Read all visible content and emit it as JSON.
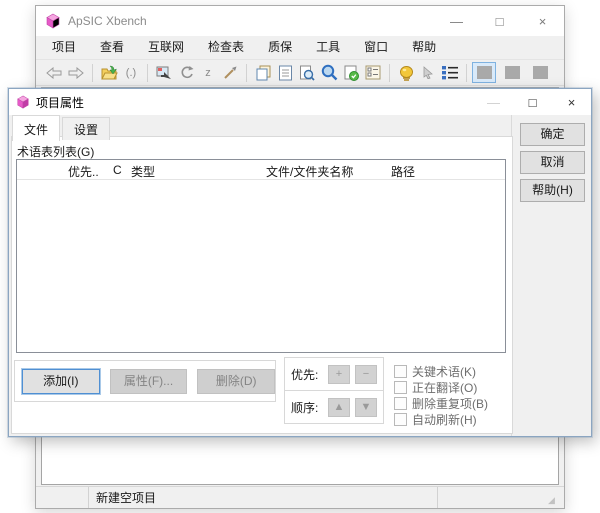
{
  "main_window": {
    "title": "ApSIC Xbench",
    "window_controls": {
      "minimize": "—",
      "maximize": "□",
      "close": "×"
    },
    "menu": [
      "项目",
      "查看",
      "互联网",
      "检查表",
      "质保",
      "工具",
      "窗口",
      "帮助"
    ],
    "toolbar_icons": [
      "back",
      "forward",
      "open-folder",
      "brackets",
      "image-edit",
      "rotate",
      "z",
      "wand",
      "copy",
      "document",
      "search-document",
      "search",
      "checked-document",
      "checklist",
      "lamp",
      "pointer",
      "list-view",
      "layout-pane-1",
      "layout-pane-2",
      "layout-pane-3"
    ],
    "status_bar": {
      "message": "新建空项目"
    }
  },
  "dialog": {
    "title": "项目属性",
    "window_controls": {
      "minimize": "—",
      "maximize": "□",
      "close": "×"
    },
    "tabs": [
      "文件",
      "设置"
    ],
    "active_tab": "文件",
    "glossary_list_label": "术语表列表(G)",
    "table": {
      "columns": [
        "",
        "优先..",
        "C",
        "类型",
        "文件/文件夹名称",
        "路径"
      ],
      "rows": []
    },
    "buttons": {
      "add": "添加(I)",
      "properties": "属性(F)...",
      "delete": "删除(D)"
    },
    "priority": {
      "label": "优先:",
      "increase": "+",
      "decrease": "−"
    },
    "order": {
      "label": "顺序:",
      "up": "▲",
      "down": "▼"
    },
    "checkboxes": [
      {
        "label": "关键术语(K)",
        "checked": false
      },
      {
        "label": "正在翻译(O)",
        "checked": false
      },
      {
        "label": "删除重复项(B)",
        "checked": false
      },
      {
        "label": "自动刷新(H)",
        "checked": false
      }
    ],
    "side_buttons": {
      "ok": "确定",
      "cancel": "取消",
      "help": "帮助(H)"
    }
  },
  "colors": {
    "dialog_border": "#8ba5c1",
    "selected_tool_bg": "#d9eafa",
    "selected_tool_border": "#7fb2e0",
    "disabled_text": "#848484",
    "app_icon_pink": "#e659c8"
  }
}
